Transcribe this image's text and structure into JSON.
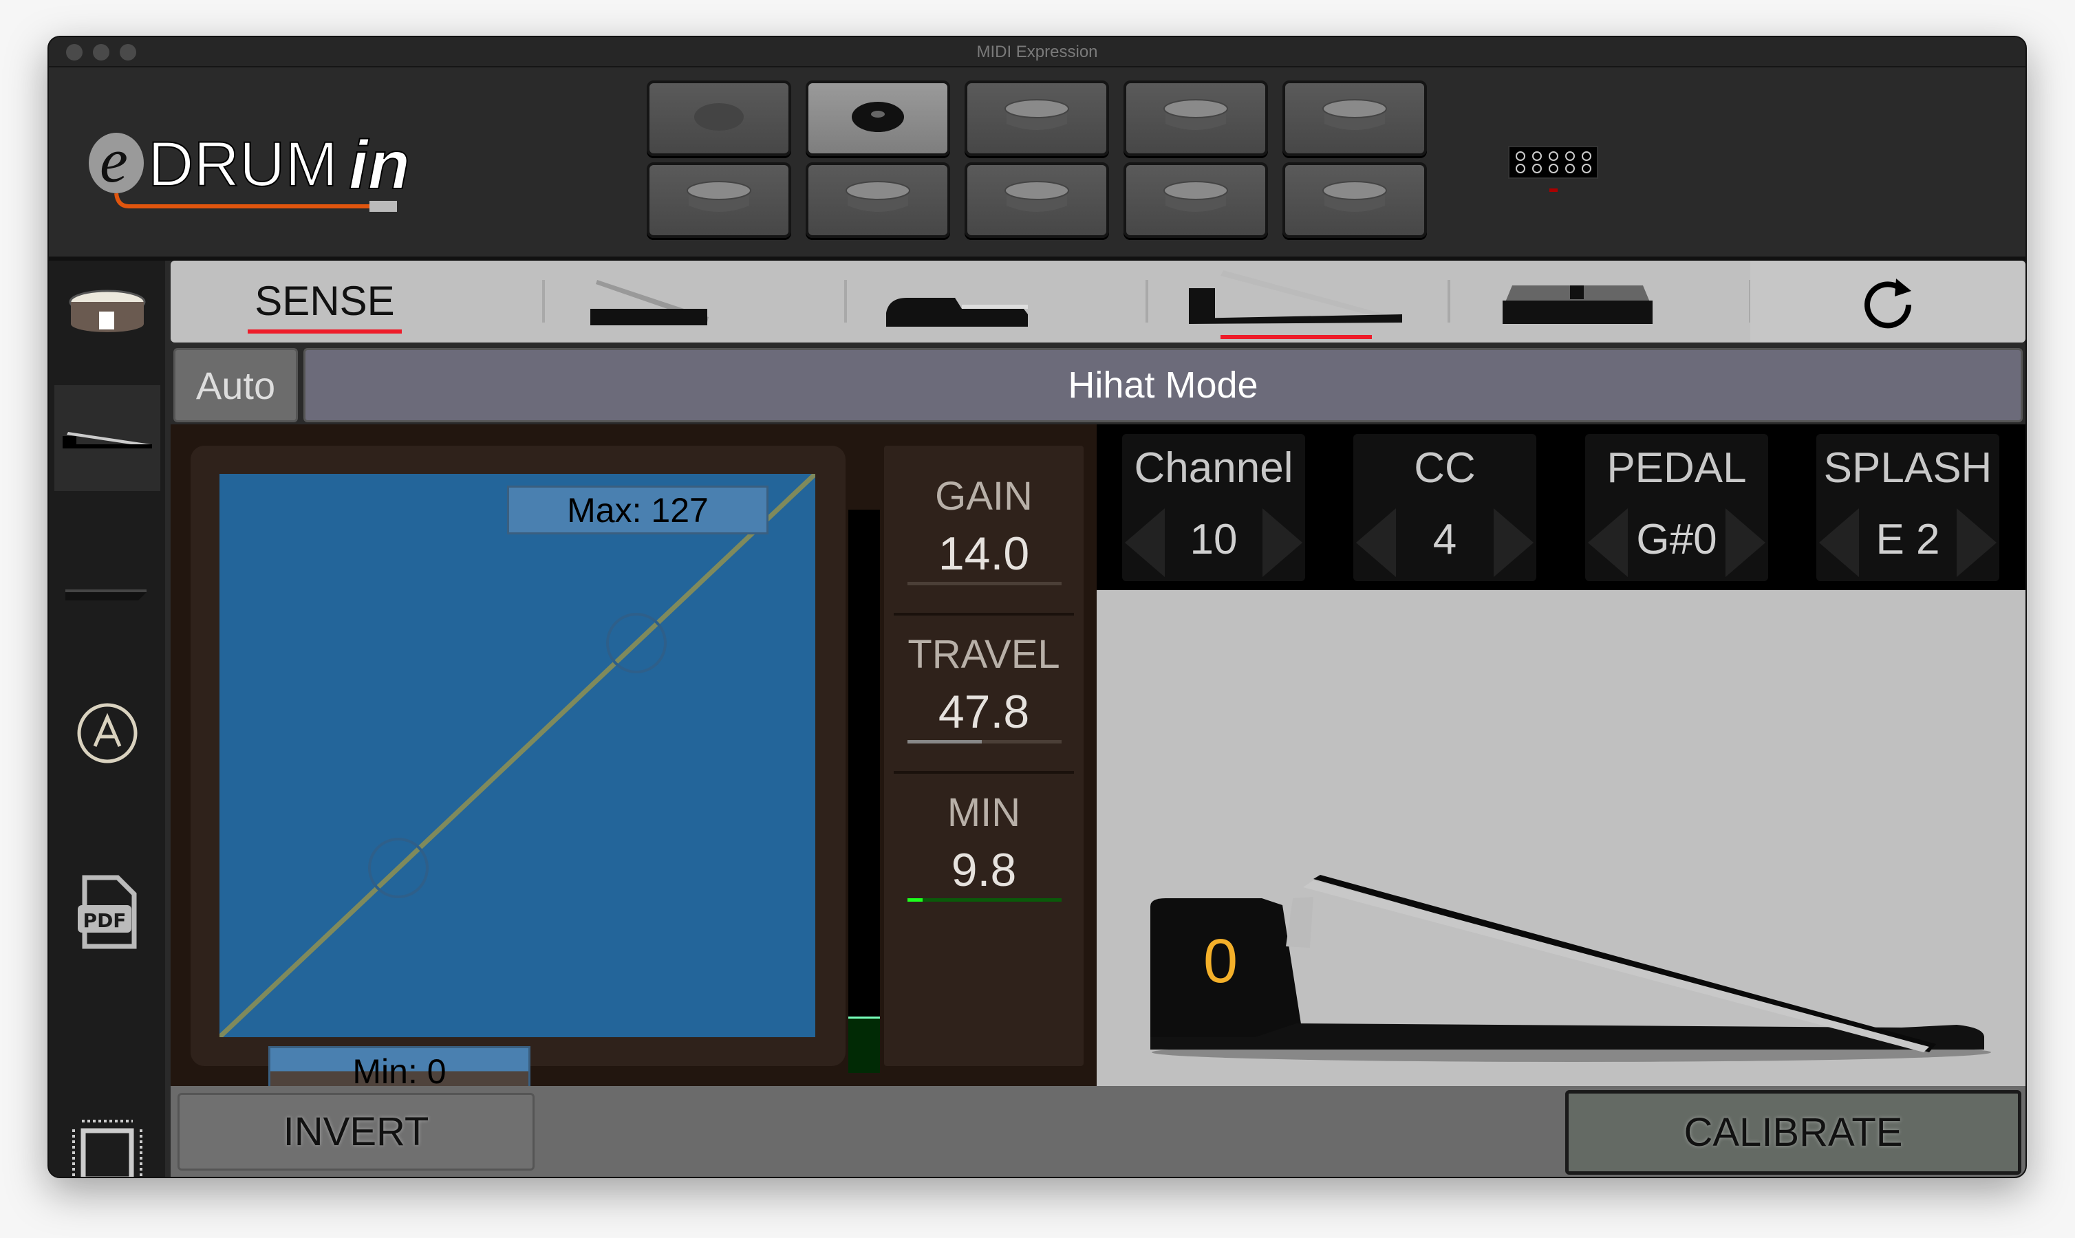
{
  "window": {
    "title": "MIDI Expression"
  },
  "logo": {
    "text": "eDRUMin"
  },
  "pads": [
    {
      "icon": "pedal-pad-icon",
      "active": false
    },
    {
      "icon": "pedal-pad-icon",
      "active": true
    },
    {
      "icon": "drum-pad-icon",
      "active": false
    },
    {
      "icon": "drum-pad-icon",
      "active": false
    },
    {
      "icon": "drum-pad-icon",
      "active": false
    },
    {
      "icon": "drum-pad-icon",
      "active": false
    },
    {
      "icon": "drum-pad-icon",
      "active": false
    },
    {
      "icon": "drum-pad-icon",
      "active": false
    },
    {
      "icon": "drum-pad-icon",
      "active": false
    },
    {
      "icon": "drum-pad-icon",
      "active": false
    }
  ],
  "sidebar": {
    "items": [
      "drum-icon",
      "hihat-pedal-icon",
      "flat-pedal-icon",
      "auto-icon",
      "pdf-icon",
      "chip-icon"
    ],
    "active": 1,
    "pdf_label": "PDF"
  },
  "tabs": {
    "sense": "SENSE",
    "items": [
      "expression-pedal",
      "sustain-pedal",
      "hihat-pedal",
      "footswitch",
      "refresh"
    ],
    "active": "hihat-pedal"
  },
  "mode": {
    "auto": "Auto",
    "title": "Hihat Mode"
  },
  "curve": {
    "max_label": "Max: 127",
    "min_label": "Min: 0",
    "fill_color": "#23659a",
    "line_color": "#7f8a5c"
  },
  "meter": {
    "level": 0.1
  },
  "stats": [
    {
      "label": "GAIN",
      "value": "14.0",
      "level": 0
    },
    {
      "label": "TRAVEL",
      "value": "47.8",
      "level": 0.48
    },
    {
      "label": "MIN",
      "value": "9.8",
      "level": 0.1
    }
  ],
  "settings": [
    {
      "label": "Channel",
      "value": "10"
    },
    {
      "label": "CC",
      "value": "4"
    },
    {
      "label": "PEDAL",
      "value": "G#0"
    },
    {
      "label": "SPLASH",
      "value": "E 2"
    }
  ],
  "pedal": {
    "value": "0",
    "value_color": "#f4b02a"
  },
  "buttons": {
    "invert": "INVERT",
    "calibrate": "CALIBRATE"
  },
  "accent": "#ee1c2a"
}
